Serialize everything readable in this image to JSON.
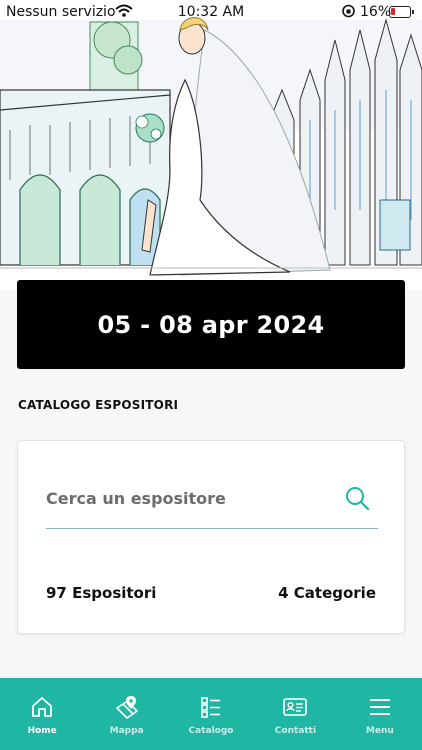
{
  "status_bar": {
    "carrier": "Nessun servizio",
    "time": "10:32 AM",
    "battery": "16%"
  },
  "hero": {
    "description_icon": "bridal-illustration"
  },
  "event": {
    "dates": "05 - 08 apr 2024"
  },
  "catalog": {
    "title": "CATALOGO ESPOSITORI",
    "search_placeholder": "Cerca un espositore",
    "exhibitors_count": "97 Espositori",
    "categories_count": "4 Categorie"
  },
  "tabbar": {
    "items": [
      {
        "label": "Home",
        "icon": "home-icon",
        "active": true
      },
      {
        "label": "Mappa",
        "icon": "map-icon",
        "active": false
      },
      {
        "label": "Catalogo",
        "icon": "catalog-icon",
        "active": false
      },
      {
        "label": "Contatti",
        "icon": "contact-card-icon",
        "active": false
      },
      {
        "label": "Menu",
        "icon": "hamburger-icon",
        "active": false
      }
    ]
  },
  "colors": {
    "accent": "#1fb7a4",
    "banner": "#000000",
    "search_underline": "#8ab5c2"
  }
}
